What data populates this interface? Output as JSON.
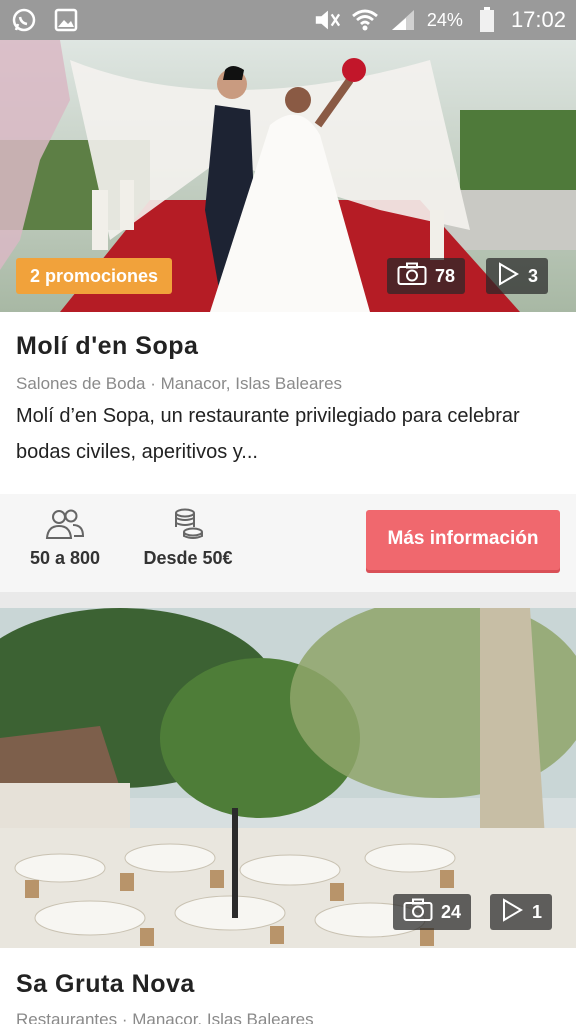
{
  "status_bar": {
    "battery_percent": "24%",
    "time": "17:02",
    "icons": [
      "whatsapp-icon",
      "gallery-icon",
      "mute-icon",
      "wifi-icon",
      "signal-icon",
      "battery-icon"
    ]
  },
  "listings": [
    {
      "promo_badge": "2 promociones",
      "photo_count": "78",
      "video_count": "3",
      "title": "Molí d'en Sopa",
      "subtitle": "Salones de Boda · Manacor, Islas Baleares",
      "description": "Molí d’en Sopa, un restaurante privilegiado para celebrar bodas civiles, aperitivos y...",
      "capacity": "50 a 800",
      "price": "Desde 50€",
      "button_label": "Más información"
    },
    {
      "photo_count": "24",
      "video_count": "1",
      "title": "Sa Gruta Nova",
      "subtitle": "Restaurantes · Manacor, Islas Baleares"
    }
  ],
  "colors": {
    "status_bar": "#9a9a9a",
    "promo": "#f1a23b",
    "button": "#f0686e",
    "background": "#e9e9e9"
  }
}
